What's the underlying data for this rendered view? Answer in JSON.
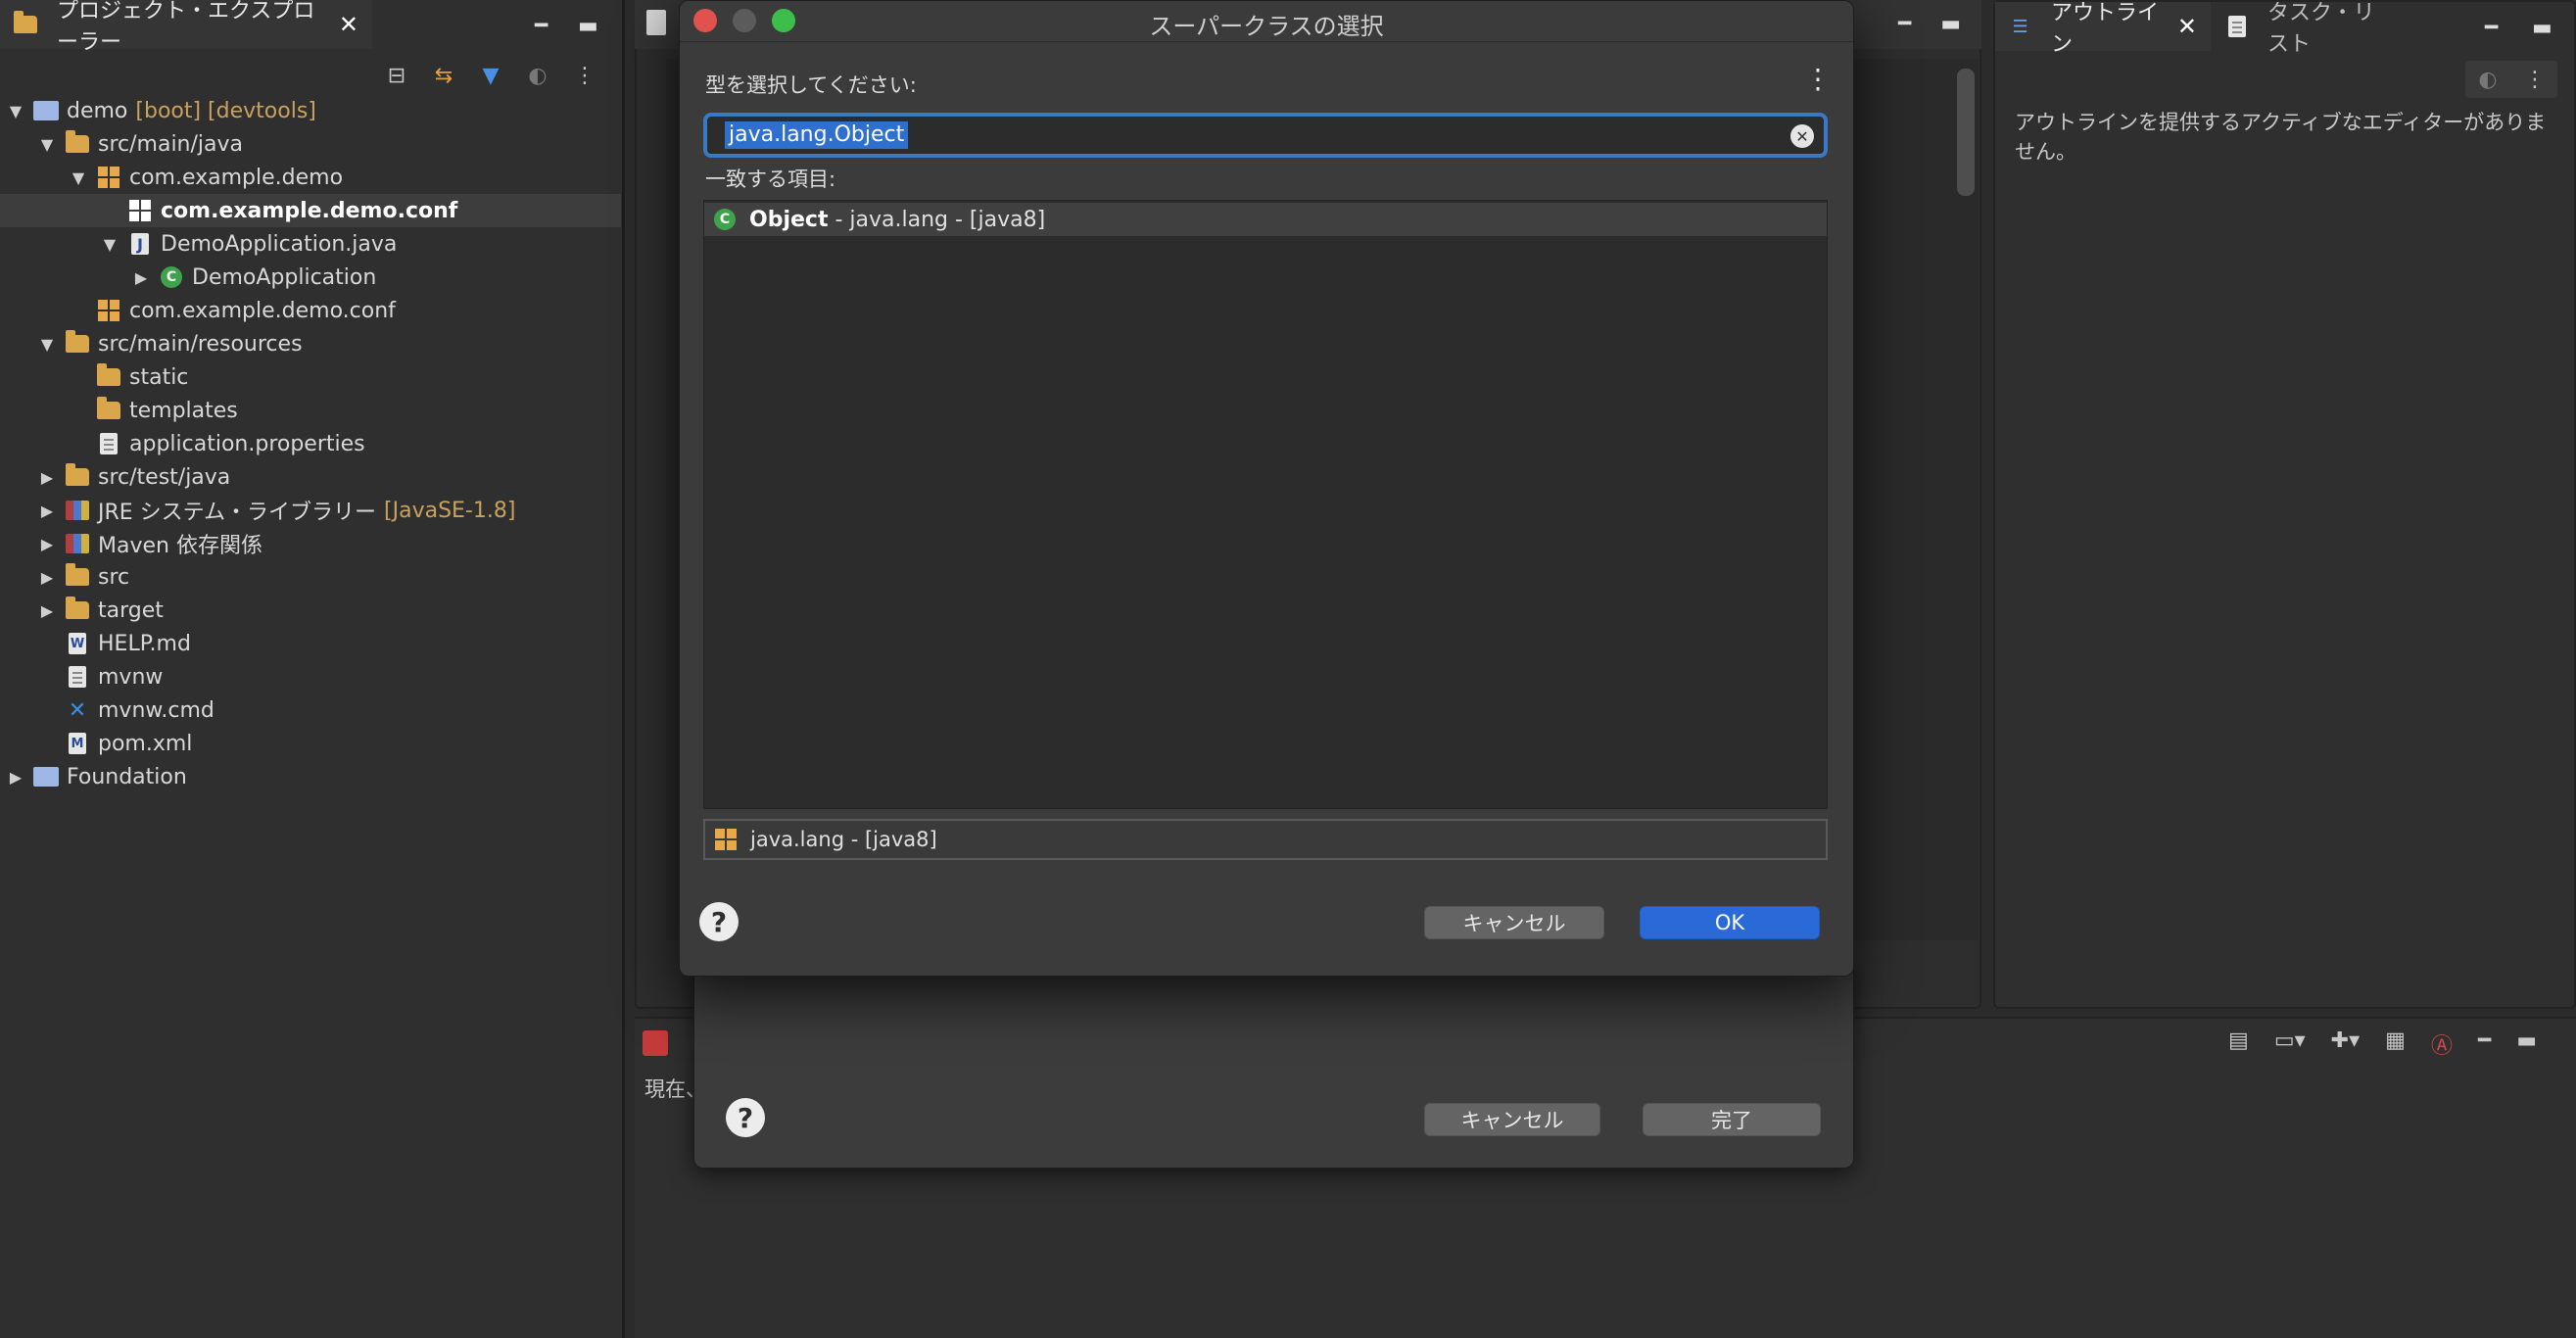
{
  "project_explorer": {
    "tab_label": "プロジェクト・エクスプローラー",
    "tree": [
      {
        "label": "demo",
        "deco": "[boot] [devtools]",
        "depth": 0,
        "twisty": "open",
        "icon": "project-icon"
      },
      {
        "label": "src/main/java",
        "depth": 1,
        "twisty": "open",
        "icon": "source-folder-icon"
      },
      {
        "label": "com.example.demo",
        "depth": 2,
        "twisty": "open",
        "icon": "package-icon"
      },
      {
        "label": "com.example.demo.conf",
        "depth": 3,
        "twisty": "none",
        "icon": "package-icon",
        "selected": true
      },
      {
        "label": "DemoApplication.java",
        "depth": 3,
        "twisty": "open",
        "icon": "java-file-icon"
      },
      {
        "label": "DemoApplication",
        "depth": 4,
        "twisty": "closed",
        "icon": "class-icon"
      },
      {
        "label": "com.example.demo.conf",
        "depth": 2,
        "twisty": "none",
        "icon": "package-icon"
      },
      {
        "label": "src/main/resources",
        "depth": 1,
        "twisty": "open",
        "icon": "source-folder-icon"
      },
      {
        "label": "static",
        "depth": 2,
        "twisty": "none",
        "icon": "folder-icon"
      },
      {
        "label": "templates",
        "depth": 2,
        "twisty": "none",
        "icon": "folder-icon"
      },
      {
        "label": "application.properties",
        "depth": 2,
        "twisty": "none",
        "icon": "file-icon"
      },
      {
        "label": "src/test/java",
        "depth": 1,
        "twisty": "closed",
        "icon": "source-folder-icon"
      },
      {
        "label": "JRE システム・ライブラリー",
        "deco": "[JavaSE-1.8]",
        "depth": 1,
        "twisty": "closed",
        "icon": "library-icon"
      },
      {
        "label": "Maven 依存関係",
        "depth": 1,
        "twisty": "closed",
        "icon": "library-icon"
      },
      {
        "label": "src",
        "depth": 1,
        "twisty": "closed",
        "icon": "folder-icon"
      },
      {
        "label": "target",
        "depth": 1,
        "twisty": "closed",
        "icon": "folder-icon"
      },
      {
        "label": "HELP.md",
        "depth": 1,
        "twisty": "none",
        "icon": "markdown-file-icon"
      },
      {
        "label": "mvnw",
        "depth": 1,
        "twisty": "none",
        "icon": "file-icon"
      },
      {
        "label": "mvnw.cmd",
        "depth": 1,
        "twisty": "none",
        "icon": "cmd-file-icon"
      },
      {
        "label": "pom.xml",
        "depth": 1,
        "twisty": "none",
        "icon": "maven-pom-icon"
      },
      {
        "label": "Foundation",
        "depth": 0,
        "twisty": "closed",
        "icon": "project-icon"
      }
    ]
  },
  "outline": {
    "tab_label": "アウトライン",
    "tasks_tab_label": "タスク・リスト",
    "message": "アウトラインを提供するアクティブなエディターがありません。"
  },
  "bottom_panel": {
    "status_text": "現在、"
  },
  "wizard": {
    "cancel_label": "キャンセル",
    "finish_label": "完了"
  },
  "dialog": {
    "title": "スーパークラスの選択",
    "prompt": "型を選択してください:",
    "search_value": "java.lang.Object",
    "matching_label": "一致する項目:",
    "matches": [
      {
        "name": "Object",
        "suffix": " - java.lang - [java8]"
      }
    ],
    "qualifier": "java.lang - [java8]",
    "cancel_label": "キャンセル",
    "ok_label": "OK"
  },
  "colors": {
    "accent": "#2a6ad8",
    "selection": "#2f6fce",
    "decoration": "#c9a25c"
  }
}
